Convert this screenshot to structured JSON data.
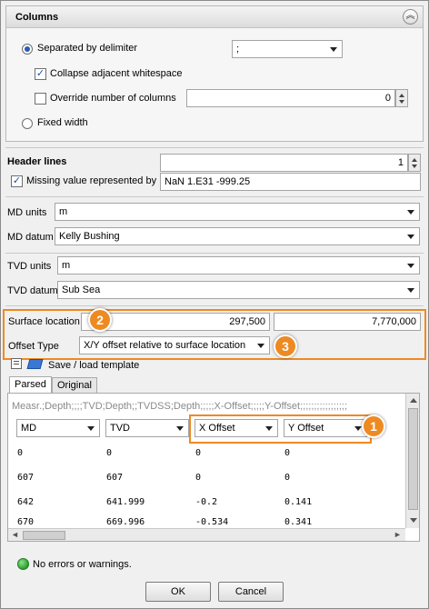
{
  "columns_panel": {
    "title": "Columns",
    "separated_label": "Separated by delimiter",
    "delimiter_value": ";",
    "collapse_label": "Collapse adjacent whitespace",
    "override_label": "Override number of columns",
    "override_value": "0",
    "fixed_width_label": "Fixed width"
  },
  "header": {
    "header_lines_label": "Header lines",
    "header_lines_value": "1",
    "missing_label": "Missing value represented by",
    "missing_value": "NaN 1.E31 -999.25"
  },
  "units": {
    "md_units_label": "MD units",
    "md_units_value": "m",
    "md_datum_label": "MD datum",
    "md_datum_value": "Kelly Bushing",
    "tvd_units_label": "TVD units",
    "tvd_units_value": "m",
    "tvd_datum_label": "TVD datum",
    "tvd_datum_value": "Sub Sea"
  },
  "surface": {
    "surface_label": "Surface location",
    "x_value": "297,500",
    "y_value": "7,770,000",
    "offset_label": "Offset Type",
    "offset_value": "X/Y offset relative to surface location"
  },
  "callouts": [
    "2",
    "3",
    "1"
  ],
  "template_label": "Save / load template",
  "tabs": [
    "Parsed",
    "Original"
  ],
  "grid": {
    "header_line": "Measr.;Depth;;;;TVD;Depth;;TVDSS;Depth;;;;;X-Offset;;;;;Y-Offset;;;;;;;;;;;;;;;;;",
    "columns": [
      "MD",
      "TVD",
      "X Offset",
      "Y Offset"
    ],
    "rows": [
      [
        "0",
        "0",
        "0",
        "0"
      ],
      [
        "607",
        "607",
        "0",
        "0"
      ],
      [
        "642",
        "641.999",
        "-0.2",
        "0.141"
      ],
      [
        "670",
        "669.996",
        "-0.534",
        "0.341"
      ]
    ],
    "scroll_left": "◄",
    "scroll_right": "►"
  },
  "status_text": "No errors or warnings.",
  "buttons": {
    "ok": "OK",
    "cancel": "Cancel"
  },
  "colors": {
    "highlight": "#ee8a22",
    "status_ok": "#2ca02c"
  }
}
